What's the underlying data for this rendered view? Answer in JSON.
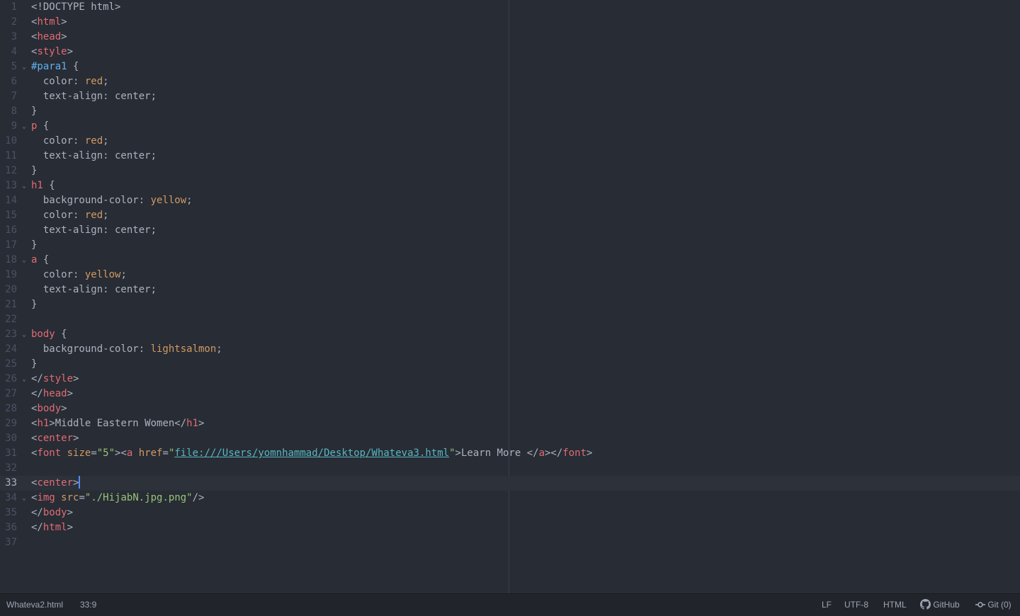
{
  "colors": {
    "background": "#282c34",
    "default": "#abb2bf",
    "tag": "#e06c75",
    "property_value": "#d19a66",
    "string": "#98c379",
    "id_selector": "#61afef",
    "link": "#56b6c2",
    "cursor": "#528bff"
  },
  "editor": {
    "cursor_line": 33,
    "lines": [
      {
        "n": "1",
        "fold": false,
        "tokens": [
          [
            "d",
            "<!DOCTYPE html>"
          ]
        ]
      },
      {
        "n": "2",
        "fold": false,
        "tokens": [
          [
            "d",
            "<"
          ],
          [
            "t",
            "html"
          ],
          [
            "d",
            ">"
          ]
        ]
      },
      {
        "n": "3",
        "fold": false,
        "tokens": [
          [
            "d",
            "<"
          ],
          [
            "t",
            "head"
          ],
          [
            "d",
            ">"
          ]
        ]
      },
      {
        "n": "4",
        "fold": false,
        "tokens": [
          [
            "d",
            "<"
          ],
          [
            "t",
            "style"
          ],
          [
            "d",
            ">"
          ]
        ]
      },
      {
        "n": "5",
        "fold": true,
        "tokens": [
          [
            "i",
            "#para1"
          ],
          [
            "d",
            " {"
          ]
        ]
      },
      {
        "n": "6",
        "fold": false,
        "tokens": [
          [
            "d",
            "  color: "
          ],
          [
            "v",
            "red"
          ],
          [
            "d",
            ";"
          ]
        ]
      },
      {
        "n": "7",
        "fold": false,
        "tokens": [
          [
            "d",
            "  text-align: center;"
          ]
        ]
      },
      {
        "n": "8",
        "fold": false,
        "tokens": [
          [
            "d",
            "}"
          ]
        ]
      },
      {
        "n": "9",
        "fold": true,
        "tokens": [
          [
            "t",
            "p"
          ],
          [
            "d",
            " {"
          ]
        ]
      },
      {
        "n": "10",
        "fold": false,
        "tokens": [
          [
            "d",
            "  color: "
          ],
          [
            "v",
            "red"
          ],
          [
            "d",
            ";"
          ]
        ]
      },
      {
        "n": "11",
        "fold": false,
        "tokens": [
          [
            "d",
            "  text-align: center;"
          ]
        ]
      },
      {
        "n": "12",
        "fold": false,
        "tokens": [
          [
            "d",
            "}"
          ]
        ]
      },
      {
        "n": "13",
        "fold": true,
        "tokens": [
          [
            "t",
            "h1"
          ],
          [
            "d",
            " {"
          ]
        ]
      },
      {
        "n": "14",
        "fold": false,
        "tokens": [
          [
            "d",
            "  background-color: "
          ],
          [
            "v",
            "yellow"
          ],
          [
            "d",
            ";"
          ]
        ]
      },
      {
        "n": "15",
        "fold": false,
        "tokens": [
          [
            "d",
            "  color: "
          ],
          [
            "v",
            "red"
          ],
          [
            "d",
            ";"
          ]
        ]
      },
      {
        "n": "16",
        "fold": false,
        "tokens": [
          [
            "d",
            "  text-align: center;"
          ]
        ]
      },
      {
        "n": "17",
        "fold": false,
        "tokens": [
          [
            "d",
            "}"
          ]
        ]
      },
      {
        "n": "18",
        "fold": true,
        "tokens": [
          [
            "t",
            "a"
          ],
          [
            "d",
            " {"
          ]
        ]
      },
      {
        "n": "19",
        "fold": false,
        "tokens": [
          [
            "d",
            "  color: "
          ],
          [
            "v",
            "yellow"
          ],
          [
            "d",
            ";"
          ]
        ]
      },
      {
        "n": "20",
        "fold": false,
        "tokens": [
          [
            "d",
            "  text-align: center;"
          ]
        ]
      },
      {
        "n": "21",
        "fold": false,
        "tokens": [
          [
            "d",
            "}"
          ]
        ]
      },
      {
        "n": "22",
        "fold": false,
        "tokens": []
      },
      {
        "n": "23",
        "fold": true,
        "tokens": [
          [
            "t",
            "body"
          ],
          [
            "d",
            " {"
          ]
        ]
      },
      {
        "n": "24",
        "fold": false,
        "tokens": [
          [
            "d",
            "  background-color: "
          ],
          [
            "v",
            "lightsalmon"
          ],
          [
            "d",
            ";"
          ]
        ]
      },
      {
        "n": "25",
        "fold": false,
        "tokens": [
          [
            "d",
            "}"
          ]
        ]
      },
      {
        "n": "26",
        "fold": true,
        "tokens": [
          [
            "d",
            "</"
          ],
          [
            "t",
            "style"
          ],
          [
            "d",
            ">"
          ]
        ]
      },
      {
        "n": "27",
        "fold": false,
        "tokens": [
          [
            "d",
            "</"
          ],
          [
            "t",
            "head"
          ],
          [
            "d",
            ">"
          ]
        ]
      },
      {
        "n": "28",
        "fold": false,
        "tokens": [
          [
            "d",
            "<"
          ],
          [
            "t",
            "body"
          ],
          [
            "d",
            ">"
          ]
        ]
      },
      {
        "n": "29",
        "fold": false,
        "tokens": [
          [
            "d",
            "<"
          ],
          [
            "t",
            "h1"
          ],
          [
            "d",
            ">Middle Eastern Women</"
          ],
          [
            "t",
            "h1"
          ],
          [
            "d",
            ">"
          ]
        ]
      },
      {
        "n": "30",
        "fold": false,
        "tokens": [
          [
            "d",
            "<"
          ],
          [
            "t",
            "center"
          ],
          [
            "d",
            ">"
          ]
        ]
      },
      {
        "n": "31",
        "fold": false,
        "tokens": [
          [
            "d",
            "<"
          ],
          [
            "t",
            "font"
          ],
          [
            "v",
            " size"
          ],
          [
            "d",
            "="
          ],
          [
            "s",
            "\"5\""
          ],
          [
            "d",
            "><"
          ],
          [
            "t",
            "a"
          ],
          [
            "v",
            " href"
          ],
          [
            "d",
            "="
          ],
          [
            "s",
            "\""
          ],
          [
            "l",
            "file:///Users/yomnhammad/Desktop/Whateva3.html"
          ],
          [
            "s",
            "\""
          ],
          [
            "d",
            ">Learn More </"
          ],
          [
            "t",
            "a"
          ],
          [
            "d",
            "></"
          ],
          [
            "t",
            "font"
          ],
          [
            "d",
            ">"
          ]
        ]
      },
      {
        "n": "32",
        "fold": false,
        "tokens": []
      },
      {
        "n": "33",
        "fold": false,
        "tokens": [
          [
            "d",
            "<"
          ],
          [
            "t",
            "center"
          ],
          [
            "d",
            ">"
          ]
        ]
      },
      {
        "n": "34",
        "fold": true,
        "tokens": [
          [
            "d",
            "<"
          ],
          [
            "t",
            "img"
          ],
          [
            "v",
            " src"
          ],
          [
            "d",
            "="
          ],
          [
            "s",
            "\"./HijabN.jpg.png\""
          ],
          [
            "d",
            "/>"
          ]
        ]
      },
      {
        "n": "35",
        "fold": false,
        "tokens": [
          [
            "d",
            "</"
          ],
          [
            "t",
            "body"
          ],
          [
            "d",
            ">"
          ]
        ]
      },
      {
        "n": "36",
        "fold": false,
        "tokens": [
          [
            "d",
            "</"
          ],
          [
            "t",
            "html"
          ],
          [
            "d",
            ">"
          ]
        ]
      },
      {
        "n": "37",
        "fold": false,
        "tokens": []
      }
    ]
  },
  "status_bar": {
    "file_name": "Whateva2.html",
    "cursor_position": "33:9",
    "line_ending": "LF",
    "encoding": "UTF-8",
    "grammar": "HTML",
    "github_label": "GitHub",
    "github_icon": "github-icon",
    "git_label": "Git (0)",
    "git_icon": "git-commit-icon"
  }
}
